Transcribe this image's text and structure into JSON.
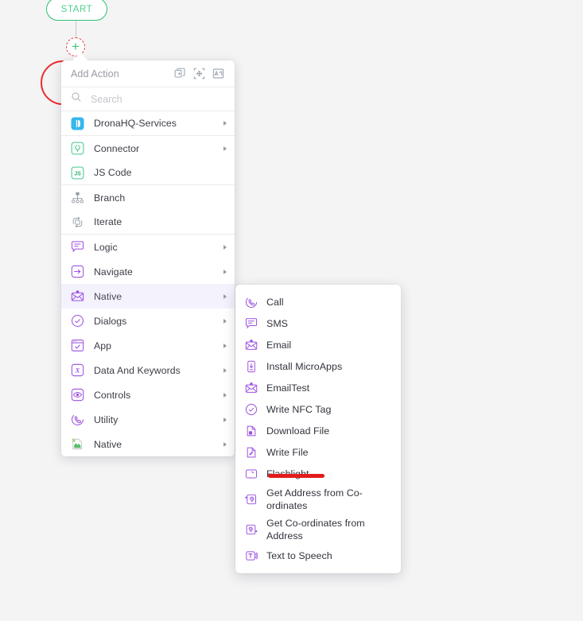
{
  "canvas": {
    "background_color": "#f4f4f5",
    "start_node": {
      "label": "START",
      "border_color": "#2fbf71",
      "text_color": "#4bd08b"
    },
    "add_node": {
      "icon": "plus-icon",
      "glyph": "+",
      "ring_color": "#e8433f",
      "plus_color": "#3ec47c"
    },
    "annotation": {
      "circle_color": "#ec2b2b",
      "underline_color": "#e31b1b"
    }
  },
  "popup": {
    "title": "Add Action",
    "header_icons": [
      {
        "name": "duplicate-icon",
        "label": "Duplicate"
      },
      {
        "name": "move-icon",
        "label": "Move"
      },
      {
        "name": "translate-icon",
        "label": "Translate"
      }
    ],
    "search": {
      "placeholder": "Search",
      "value": "",
      "icon": "search-icon"
    },
    "items": [
      {
        "label": "DronaHQ-Services",
        "icon": "dronahq-logo-icon",
        "has_submenu": true,
        "group_end": true
      },
      {
        "label": "Connector",
        "icon": "plug-icon",
        "has_submenu": true,
        "group_end": false
      },
      {
        "label": "JS Code",
        "icon": "js-icon",
        "has_submenu": false,
        "group_end": true
      },
      {
        "label": "Branch",
        "icon": "branch-icon",
        "has_submenu": false,
        "group_end": false
      },
      {
        "label": "Iterate",
        "icon": "loop-icon",
        "has_submenu": false,
        "group_end": true
      },
      {
        "label": "Logic",
        "icon": "logic-icon",
        "has_submenu": true,
        "group_end": false
      },
      {
        "label": "Navigate",
        "icon": "navigate-icon",
        "has_submenu": true,
        "group_end": false
      },
      {
        "label": "Native",
        "icon": "envelope-icon",
        "has_submenu": true,
        "group_end": false,
        "active": true
      },
      {
        "label": "Dialogs",
        "icon": "check-circle-icon",
        "has_submenu": true,
        "group_end": false
      },
      {
        "label": "App",
        "icon": "app-window-icon",
        "has_submenu": true,
        "group_end": false
      },
      {
        "label": "Data And Keywords",
        "icon": "variable-x-icon",
        "has_submenu": true,
        "group_end": false
      },
      {
        "label": "Controls",
        "icon": "eye-icon",
        "has_submenu": true,
        "group_end": false
      },
      {
        "label": "Utility",
        "icon": "phone-circle-icon",
        "has_submenu": true,
        "group_end": false
      },
      {
        "label": "Native",
        "icon": "broken-image-icon",
        "has_submenu": true,
        "group_end": false
      }
    ]
  },
  "submenu": {
    "parent": "Native",
    "items": [
      {
        "label": "Call",
        "icon": "phone-circle-icon"
      },
      {
        "label": "SMS",
        "icon": "chat-icon"
      },
      {
        "label": "Email",
        "icon": "envelope-icon"
      },
      {
        "label": "Install MicroApps",
        "icon": "phone-download-icon"
      },
      {
        "label": "EmailTest",
        "icon": "envelope-icon"
      },
      {
        "label": "Write NFC Tag",
        "icon": "check-circle-icon"
      },
      {
        "label": "Download File",
        "icon": "file-download-icon"
      },
      {
        "label": "Write File",
        "icon": "file-edit-icon"
      },
      {
        "label": "Flashlight",
        "icon": "flashlight-icon",
        "highlighted": true
      },
      {
        "label": "Get Address from Co-ordinates",
        "icon": "location-out-icon",
        "two_line": true
      },
      {
        "label": "Get Co-ordinates from Address",
        "icon": "location-in-icon",
        "two_line": true
      },
      {
        "label": "Text to Speech",
        "icon": "text-speech-icon"
      }
    ]
  }
}
